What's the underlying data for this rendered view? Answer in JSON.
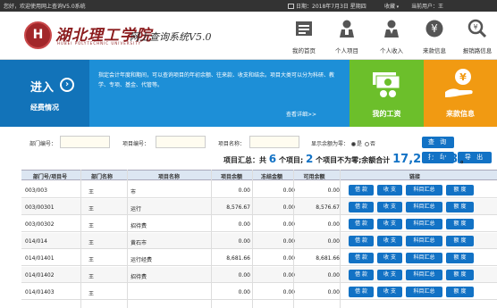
{
  "topbar": {
    "welcome": "您好，欢迎使用网上查询V5.0系统",
    "date": "日期：2018年7月3日 星期四",
    "favorites": "收藏",
    "current_user": "当前用户：王"
  },
  "header": {
    "logo_mark": "H",
    "logo_name": "湖北理工学院",
    "logo_sub": "HUBEI POLYTECHNIC UNIVERSITY",
    "system_name": "网上查询系统V5.0",
    "nav": [
      {
        "label": "我的首页",
        "icon": "home-icon"
      },
      {
        "label": "个人项目",
        "icon": "person-project-icon"
      },
      {
        "label": "个人收入",
        "icon": "person-income-icon"
      },
      {
        "label": "来款信息",
        "icon": "payment-info-icon"
      },
      {
        "label": "报销路信息",
        "icon": "reimburse-info-icon"
      }
    ]
  },
  "banner": {
    "enter_label": "进入",
    "section_label": "经费情况",
    "description": "指定会计年度和期间，可以查询项目的年初余额、往来款、收支和结余。项目大类可以分为科研、教学、专项、基金、代管等。",
    "more": "查看详细>>",
    "salary_label": "我的工资",
    "income_label": "来款信息"
  },
  "search": {
    "dept_label": "部门编号：",
    "dept_value": "",
    "project_label": "项目编号：",
    "project_value": "",
    "name_label": "项目名称：",
    "name_value": "",
    "show_zero_label": "显示余额为零：",
    "opt_yes": "是",
    "opt_no": "否",
    "query_btn": "查 询",
    "print_btn": "打 印",
    "export_btn": "导 出"
  },
  "summary": {
    "prefix": "项目汇总：共",
    "total_projects": "6",
    "mid1": "个项目;",
    "zero_projects": "2",
    "mid2": "个项目不为零;余额合计",
    "total_balance": "17,258.33",
    "suffix": "。"
  },
  "table": {
    "headers": [
      "部门号/项目号",
      "部门名称",
      "项目名称",
      "项目余额",
      "冻结金额",
      "可用余额",
      "链接"
    ],
    "actions": [
      "借 款",
      "收 支",
      "科目汇总",
      "额 度"
    ],
    "rows": [
      {
        "code": "003/003",
        "dept": "王",
        "name": "市",
        "balance": "0.00",
        "frozen": "0.00",
        "available": "0.00"
      },
      {
        "code": "003/00301",
        "dept": "王",
        "name": "运行",
        "balance": "8,576.67",
        "frozen": "0.00",
        "available": "8,576.67"
      },
      {
        "code": "003/00302",
        "dept": "王",
        "name": "招待费",
        "balance": "0.00",
        "frozen": "0.00",
        "available": "0.00"
      },
      {
        "code": "014/014",
        "dept": "王",
        "name": "黄石市",
        "balance": "0.00",
        "frozen": "0.00",
        "available": "0.00"
      },
      {
        "code": "014/01401",
        "dept": "王",
        "name": "运行经费",
        "balance": "8,681.66",
        "frozen": "0.00",
        "available": "8,681.66"
      },
      {
        "code": "014/01402",
        "dept": "王",
        "name": "招待费",
        "balance": "0.00",
        "frozen": "0.00",
        "available": "0.00"
      },
      {
        "code": "014/01403",
        "dept": "王",
        "name": "",
        "balance": "0.00",
        "frozen": "0.00",
        "available": "0.00"
      }
    ]
  },
  "colors": {
    "accent": "#1272c5",
    "banner_blue": "#1d8fd7",
    "green": "#6cbf2b",
    "orange": "#f19a12",
    "logo_red": "#8b1c1e"
  }
}
